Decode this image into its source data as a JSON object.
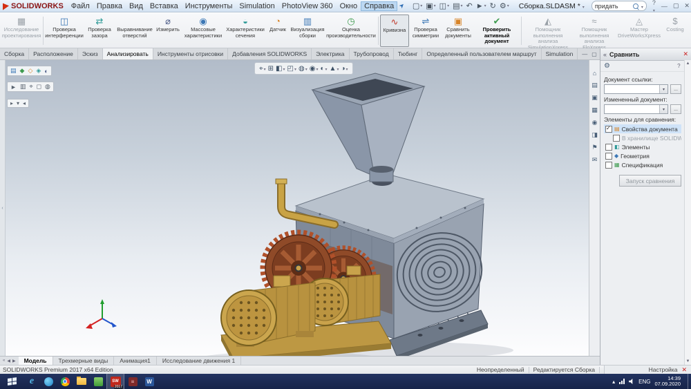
{
  "titlebar": {
    "brand": "SOLIDWORKS",
    "doc_title": "Сборка.SLDASM *",
    "search_value": "придать",
    "help": "?",
    "min": "—",
    "max": "▢",
    "close": "✕",
    "menus": [
      "Файл",
      "Правка",
      "Вид",
      "Вставка",
      "Инструменты",
      "Simulation",
      "PhotoView 360",
      "Окно",
      "Справка"
    ]
  },
  "qat": {
    "icons": [
      {
        "name": "new-document-icon",
        "g": "▢"
      },
      {
        "name": "open-document-icon",
        "g": "▣"
      },
      {
        "name": "save-icon",
        "g": "◫"
      },
      {
        "name": "print-icon",
        "g": "▤"
      },
      {
        "name": "undo-icon",
        "g": "↶"
      },
      {
        "name": "select-icon",
        "g": "►"
      },
      {
        "name": "rebuild-icon",
        "g": "↻"
      },
      {
        "name": "options-icon",
        "g": "⚙"
      }
    ]
  },
  "ribbon": {
    "buttons": [
      {
        "label": "Исследование\nпроектирования",
        "icon": "▦"
      },
      {
        "label": "Проверка\nинтерференции",
        "icon": "◫"
      },
      {
        "label": "Проверка\nзазора",
        "icon": "⇄"
      },
      {
        "label": "Выравнивание\nотверстий",
        "icon": "◎"
      },
      {
        "label": "Измерить",
        "icon": "⌀"
      },
      {
        "label": "Массовые\nхарактеристики",
        "icon": "◉"
      },
      {
        "label": "Характеристики\nсечения",
        "icon": "◒"
      },
      {
        "label": "Датчик",
        "icon": "◔"
      },
      {
        "label": "Визуализация\nсборки",
        "icon": "▥"
      },
      {
        "label": "Оценка\nпроизводительности",
        "icon": "◷"
      },
      {
        "label": "Кривизна",
        "icon": "∿"
      },
      {
        "label": "Проверка\nсимметрии",
        "icon": "⇌"
      },
      {
        "label": "Сравнить\nдокументы",
        "icon": "▣"
      },
      {
        "label": "Проверить\nактивный документ",
        "icon": "✔"
      },
      {
        "label": "Помощник\nвыполнения анализа\nSimulationXpress",
        "icon": "◭"
      },
      {
        "label": "Помощник\nвыполнения\nанализа FloXpress",
        "icon": "≈"
      },
      {
        "label": "Мастер\nDriveWorksXpress",
        "icon": "◬"
      },
      {
        "label": "Costing",
        "icon": "$"
      }
    ]
  },
  "tabs": {
    "items": [
      "Сборка",
      "Расположение",
      "Эскиз",
      "Анализировать",
      "Инструменты отрисовки",
      "Добавления SOLIDWORKS",
      "Электрика",
      "Трубопровод",
      "Тюбинг",
      "Определенный пользователем маршрут",
      "Simulation"
    ]
  },
  "hud": {
    "icons": [
      {
        "name": "zoom-fit-icon",
        "g": "⌖"
      },
      {
        "name": "zoom-area-icon",
        "g": "⊞"
      },
      {
        "name": "section-view-icon",
        "g": "◧"
      },
      {
        "name": "view-orientation-icon",
        "g": "◰"
      },
      {
        "name": "display-style-icon",
        "g": "◍"
      },
      {
        "name": "hide-show-icon",
        "g": "◉"
      },
      {
        "name": "edit-appearance-icon",
        "g": "◐"
      },
      {
        "name": "apply-scene-icon",
        "g": "▲"
      },
      {
        "name": "view-settings-icon",
        "g": "◑"
      }
    ]
  },
  "fm": {
    "tabs": [
      {
        "name": "featuremanager-tree-icon",
        "g": "▤"
      },
      {
        "name": "propertymanager-icon",
        "g": "◆"
      },
      {
        "name": "configurationmanager-icon",
        "g": "◇"
      },
      {
        "name": "dimxpert-icon",
        "g": "◈"
      },
      {
        "name": "displaymanager-icon",
        "g": "◐"
      }
    ],
    "toolbar": [
      {
        "name": "select-filter-icon",
        "g": "►"
      },
      {
        "name": "hierarchy-icon",
        "g": "▥"
      },
      {
        "name": "filter-icon",
        "g": "⌖"
      },
      {
        "name": "show-hide-tree-icon",
        "g": "◻"
      },
      {
        "name": "appearance-filter-icon",
        "g": "◍"
      }
    ],
    "mini": [
      {
        "name": "expand-tree-icon",
        "g": "▸"
      },
      {
        "name": "collapse-tree-icon",
        "g": "▾"
      },
      {
        "name": "pin-tree-icon",
        "g": "◂"
      }
    ]
  },
  "taskpane": {
    "title": "Сравнить",
    "strip": [
      {
        "name": "resources-icon",
        "g": "⌂"
      },
      {
        "name": "design-library-icon",
        "g": "▤"
      },
      {
        "name": "file-explorer-icon",
        "g": "▣"
      },
      {
        "name": "view-palette-icon",
        "g": "▦"
      },
      {
        "name": "appearances-icon",
        "g": "◉"
      },
      {
        "name": "scenes-icon",
        "g": "◨"
      },
      {
        "name": "custom-properties-icon",
        "g": "⚑"
      },
      {
        "name": "solidworks-forum-icon",
        "g": "✉"
      }
    ],
    "compare": {
      "ref_label": "Документ ссылки:",
      "mod_label": "Измененный документ:",
      "items_label": "Элементы для сравнения:",
      "browse": "...",
      "checkboxes": [
        {
          "label": "Свойства документа"
        },
        {
          "label": "В хранилище SOLIDWORKS PD"
        },
        {
          "label": "Элементы"
        },
        {
          "label": "Геометрия"
        },
        {
          "label": "Спецификация"
        }
      ],
      "run_label": "Запуск сравнения"
    }
  },
  "bottom_tabs": {
    "items": [
      "Модель",
      "Трехмерные виды",
      "Анимация1",
      "Исследование движения 1"
    ]
  },
  "statusbar": {
    "edition": "SOLIDWORKS Premium 2017 x64 Edition",
    "state": "Неопределенный",
    "mode": "Редактируется Сборка",
    "right": "Настройка"
  },
  "taskbar": {
    "lang": "ENG",
    "time": "14:39",
    "date": "07.09.2020",
    "ie_glyph": "e",
    "sw_glyph": "SW",
    "solidworks_badge": "2017",
    "winrar_glyph": "≡",
    "word_glyph": "W"
  }
}
